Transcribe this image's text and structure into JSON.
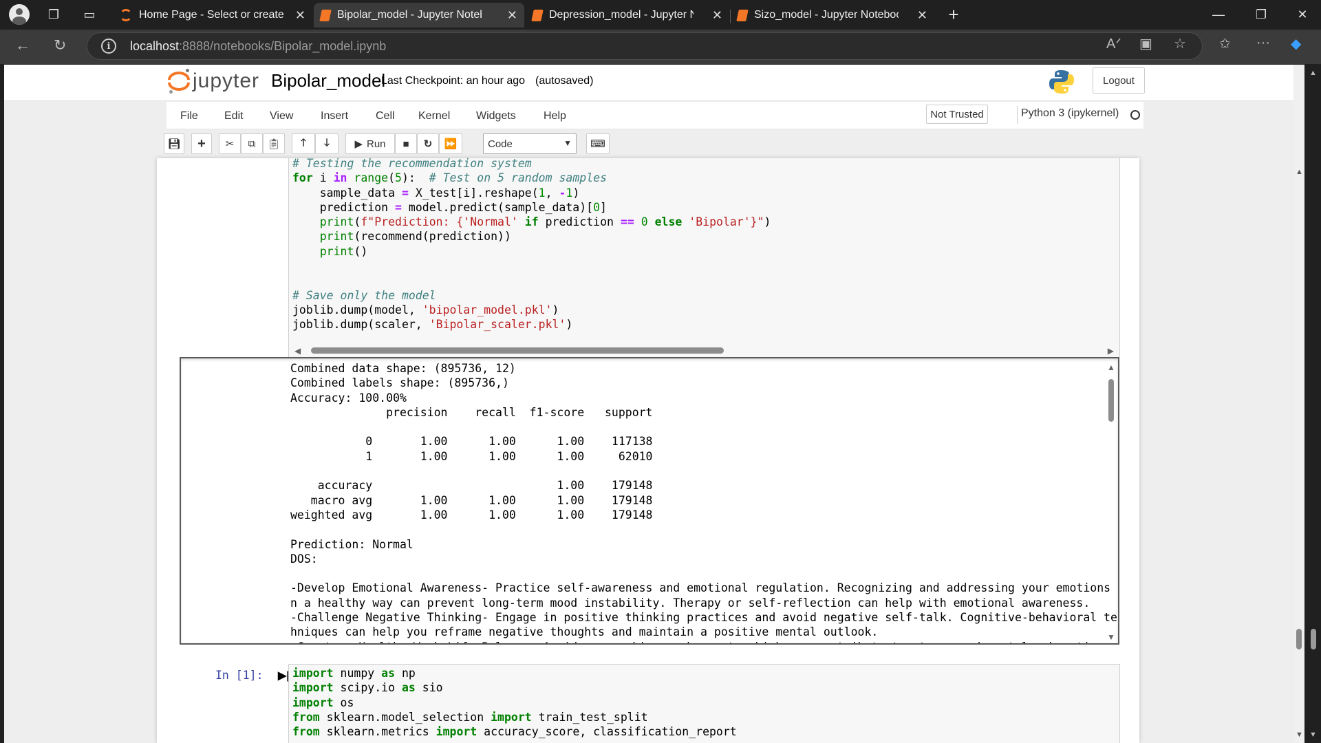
{
  "browser": {
    "tabs": [
      {
        "title": "Home Page - Select or create a notebook",
        "active": false
      },
      {
        "title": "Bipolar_model - Jupyter Notebook",
        "active": true
      },
      {
        "title": "Depression_model - Jupyter Notebook",
        "active": false
      },
      {
        "title": "Sizo_model - Jupyter Notebook",
        "active": false
      }
    ],
    "url_host": "localhost",
    "url_rest": ":8888/notebooks/Bipolar_model.ipynb"
  },
  "header": {
    "logo_text": "jupyter",
    "notebook_name": "Bipolar_model",
    "checkpoint": "Last Checkpoint: an hour ago",
    "autosaved": "(autosaved)",
    "logout": "Logout"
  },
  "menu": [
    "File",
    "Edit",
    "View",
    "Insert",
    "Cell",
    "Kernel",
    "Widgets",
    "Help"
  ],
  "status": {
    "trust": "Not Trusted",
    "kernel": "Python 3 (ipykernel)"
  },
  "toolbar": {
    "run_label": "Run",
    "cell_type": "Code"
  },
  "cells": {
    "prompt2": "In [1]:",
    "output_lines": [
      "Combined data shape: (895736, 12)",
      "Combined labels shape: (895736,)",
      "Accuracy: 100.00%",
      "              precision    recall  f1-score   support",
      "",
      "           0       1.00      1.00      1.00    117138",
      "           1       1.00      1.00      1.00     62010",
      "",
      "    accuracy                           1.00    179148",
      "   macro avg       1.00      1.00      1.00    179148",
      "weighted avg       1.00      1.00      1.00    179148",
      "",
      "Prediction: Normal",
      "DOS:",
      "",
      "-Develop Emotional Awareness- Practice self-awareness and emotional regulation. Recognizing and addressing your emotions i",
      "n a healthy way can prevent long-term mood instability. Therapy or self-reflection can help with emotional awareness.",
      "-Challenge Negative Thinking- Engage in positive thinking practices and avoid negative self-talk. Cognitive-behavioral tec",
      "hniques can help you reframe negative thoughts and maintain a positive mental outlook.",
      "-Create a Healthy Work-Life Balance- Avoid overworking or burnout, which can contribute to stress and mental exhaustion. P"
    ]
  }
}
